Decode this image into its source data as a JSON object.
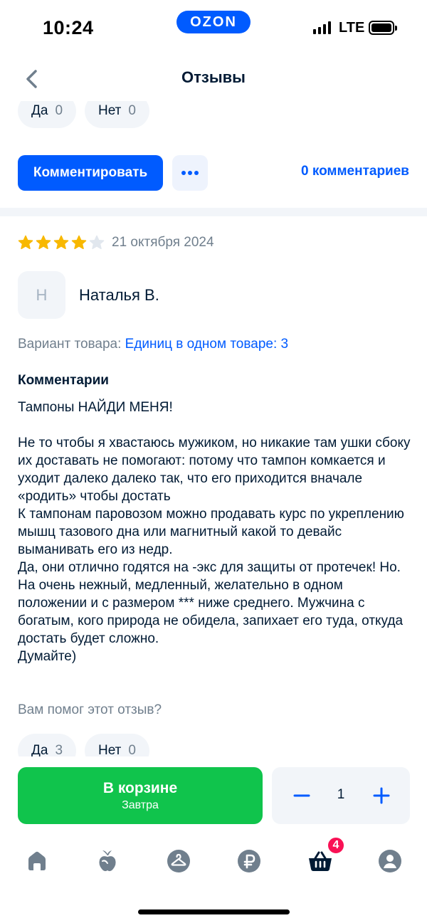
{
  "status_bar": {
    "time": "10:24",
    "brand": "OZON",
    "network": "LTE"
  },
  "header": {
    "title": "Отзывы",
    "back_icon": "chevron-left-icon"
  },
  "prev_review": {
    "votes": {
      "yes_label": "Да",
      "yes_count": "0",
      "no_label": "Нет",
      "no_count": "0"
    },
    "comment_button": "Комментировать",
    "more_icon": "more-dots-icon",
    "comments_link": "0 комментариев"
  },
  "review": {
    "rating": 4,
    "rating_max": 5,
    "date": "21 октября 2024",
    "author_initial": "Н",
    "author_name": "Наталья В.",
    "variant_label": "Вариант товара:",
    "variant_value": "Единиц в одном товаре: 3",
    "comments_title": "Комментарии",
    "comment_text": "Тампоны НАЙДИ МЕНЯ!\n\nНе то чтобы я хвастаюсь мужиком, но никакие там ушки сбоку их доставать не помогают: потому что тампон комкается и уходит далеко далеко так, что его приходится вначале «родить» чтобы достать\nК тампонам паровозом можно продавать курс по укреплению мышц тазового дна или магнитный какой то девайс выманивать его из недр.\nДа, они отлично годятся на -экс для защиты от протечек! Но. На очень нежный, медленный, желательно в одном положении и с размером *** ниже среднего. Мужчина с богатым, кого природа не обидела, запихает его туда, откуда достать будет сложно.\nДумайте)",
    "helpful_question": "Вам помог этот отзыв?",
    "votes": {
      "yes_label": "Да",
      "yes_count": "3",
      "no_label": "Нет",
      "no_count": "0"
    }
  },
  "buy_bar": {
    "cart_label": "В корзине",
    "delivery": "Завтра",
    "quantity": "1"
  },
  "tab_bar": {
    "items": [
      "home-icon",
      "fresh-icon",
      "clothes-hanger-icon",
      "ruble-icon",
      "cart-icon",
      "profile-icon"
    ],
    "cart_badge": "4"
  },
  "colors": {
    "accent": "#005bff",
    "green": "#10c44c",
    "star": "#f8b800",
    "badge": "#f91155",
    "icon_gray": "#707f8d"
  }
}
